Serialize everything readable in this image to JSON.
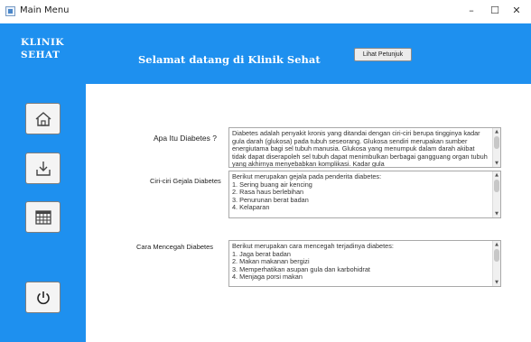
{
  "window": {
    "title": "Main Menu",
    "controls": {
      "minimize": "–",
      "maximize": "☐",
      "close": "✕"
    }
  },
  "brand": {
    "line1": "KLINIK",
    "line2": "SEHAT"
  },
  "header": {
    "welcome": "Selamat datang di Klinik Sehat",
    "guide_button": "Lihat Petunjuk"
  },
  "sidebar": {
    "buttons": [
      {
        "icon": "home-icon"
      },
      {
        "icon": "download-icon"
      },
      {
        "icon": "table-icon"
      },
      {
        "icon": "power-icon"
      }
    ]
  },
  "sections": [
    {
      "label": "Apa Itu Diabetes ?",
      "text": "Diabetes adalah penyakit kronis yang ditandai dengan ciri-ciri berupa tingginya kadar gula darah (glukosa) pada tubuh seseorang. Glukosa sendiri merupakan sumber energiutama bagi sel tubuh manusia. Glukosa yang menumpuk dalam darah akibat tidak dapat diserapoleh sel tubuh dapat menimbulkan berbagai gangguang organ tubuh yang akhirnya menyebabkan komplikasi. Kadar gula"
    },
    {
      "label": "Ciri-ciri Gejala Diabetes",
      "text": "Berikut merupakan gejala pada penderita diabetes:\n1. Sering buang air kencing\n2. Rasa haus berlebihan\n3. Penurunan berat badan\n4. Kelaparan"
    },
    {
      "label": "Cara Mencegah Diabetes",
      "text": "Berikut merupakan cara mencegah terjadinya diabetes:\n1. Jaga berat badan\n2. Makan makanan bergizi\n3. Memperhatikan asupan gula dan karbohidrat\n4. Menjaga porsi makan"
    }
  ]
}
